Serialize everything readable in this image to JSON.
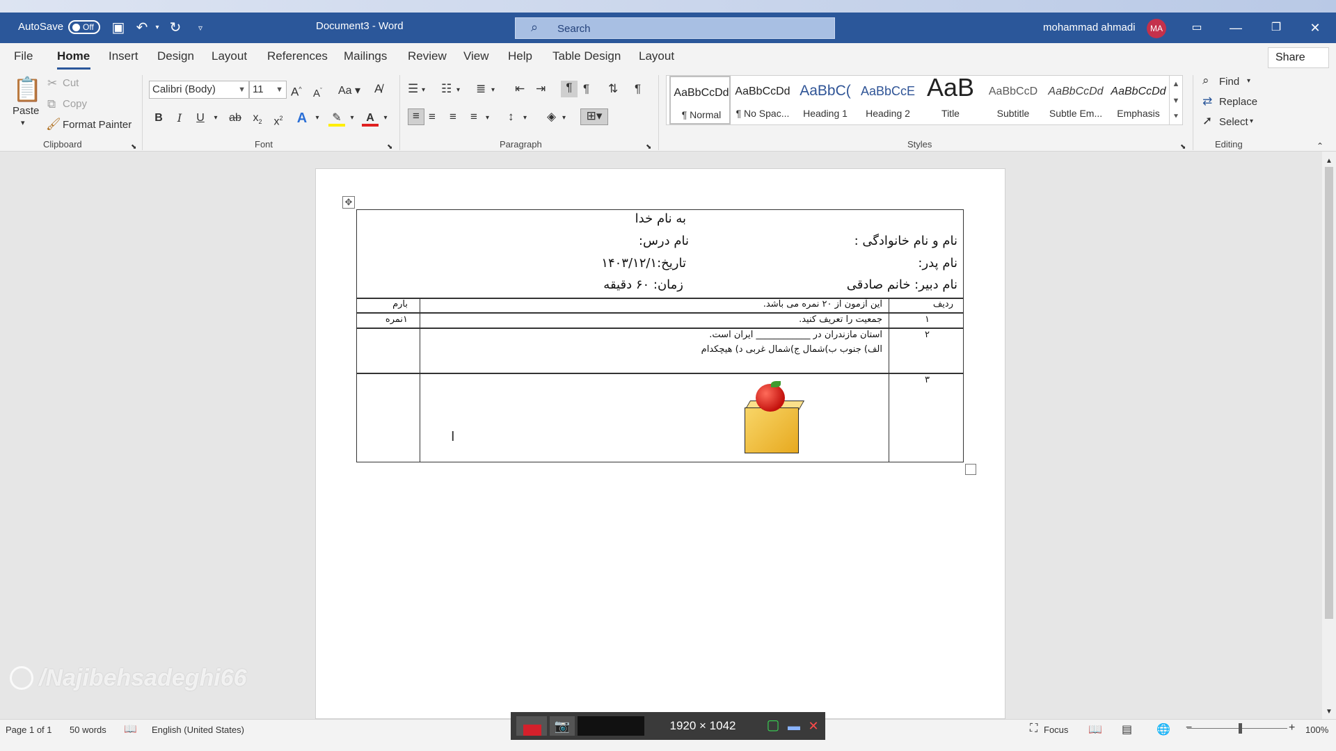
{
  "titlebar": {
    "autosave_label": "AutoSave",
    "autosave_state": "Off",
    "doc_title": "Document3  -  Word",
    "search_placeholder": "Search",
    "user_name": "mohammad ahmadi",
    "user_initials": "MA"
  },
  "tabs": [
    "File",
    "Home",
    "Insert",
    "Design",
    "Layout",
    "References",
    "Mailings",
    "Review",
    "View",
    "Help",
    "Table Design",
    "Layout"
  ],
  "active_tab": "Home",
  "share_label": "Share",
  "clipboard": {
    "paste": "Paste",
    "cut": "Cut",
    "copy": "Copy",
    "format_painter": "Format Painter",
    "group": "Clipboard"
  },
  "font": {
    "family": "Calibri (Body)",
    "size": "11",
    "group": "Font",
    "case_label": "Aa"
  },
  "paragraph": {
    "group": "Paragraph"
  },
  "styles": {
    "group": "Styles",
    "items": [
      {
        "preview": "AaBbCcDd",
        "name": "¶ Normal"
      },
      {
        "preview": "AaBbCcDd",
        "name": "¶ No Spac..."
      },
      {
        "preview": "AaBbC(",
        "name": "Heading 1"
      },
      {
        "preview": "AaBbCcE",
        "name": "Heading 2"
      },
      {
        "preview": "AaB",
        "name": "Title"
      },
      {
        "preview": "AaBbCcD",
        "name": "Subtitle"
      },
      {
        "preview": "AaBbCcDd",
        "name": "Subtle Em..."
      },
      {
        "preview": "AaBbCcDd",
        "name": "Emphasis"
      }
    ]
  },
  "editing": {
    "find": "Find",
    "replace": "Replace",
    "select": "Select",
    "group": "Editing"
  },
  "document": {
    "header": {
      "bismillah": "به نام خدا",
      "name_family": "نام و نام خانوادگی :",
      "course": "نام درس:",
      "father": "نام پدر:",
      "date": "تاریخ:۱۴۰۳/۱۲/۱",
      "teacher": "نام دبیر: خانم صادقی",
      "time": "زمان: ۶۰ دقیقه"
    },
    "table": {
      "col_row": "ردیف",
      "col_score": "بارم",
      "intro": "این آزمون از ۲۰ نمره می باشد.",
      "rows": [
        {
          "num": "۱",
          "question": "جمعیت را تعریف کنید.",
          "score": "۱نمره"
        },
        {
          "num": "۲",
          "question": "استان مازندران در ____________ ایران است.",
          "options": "الف) جنوب            ب)شمال                  ج)شمال غربی           د) هیچکدام",
          "score": ""
        },
        {
          "num": "۳",
          "question": "",
          "score": ""
        }
      ]
    }
  },
  "watermark": "/Najibehsadeghi66",
  "statusbar": {
    "page": "Page 1 of 1",
    "words": "50 words",
    "language": "English (United States)",
    "recorder_size": "1920 × 1042",
    "focus": "Focus",
    "zoom": "100%"
  }
}
